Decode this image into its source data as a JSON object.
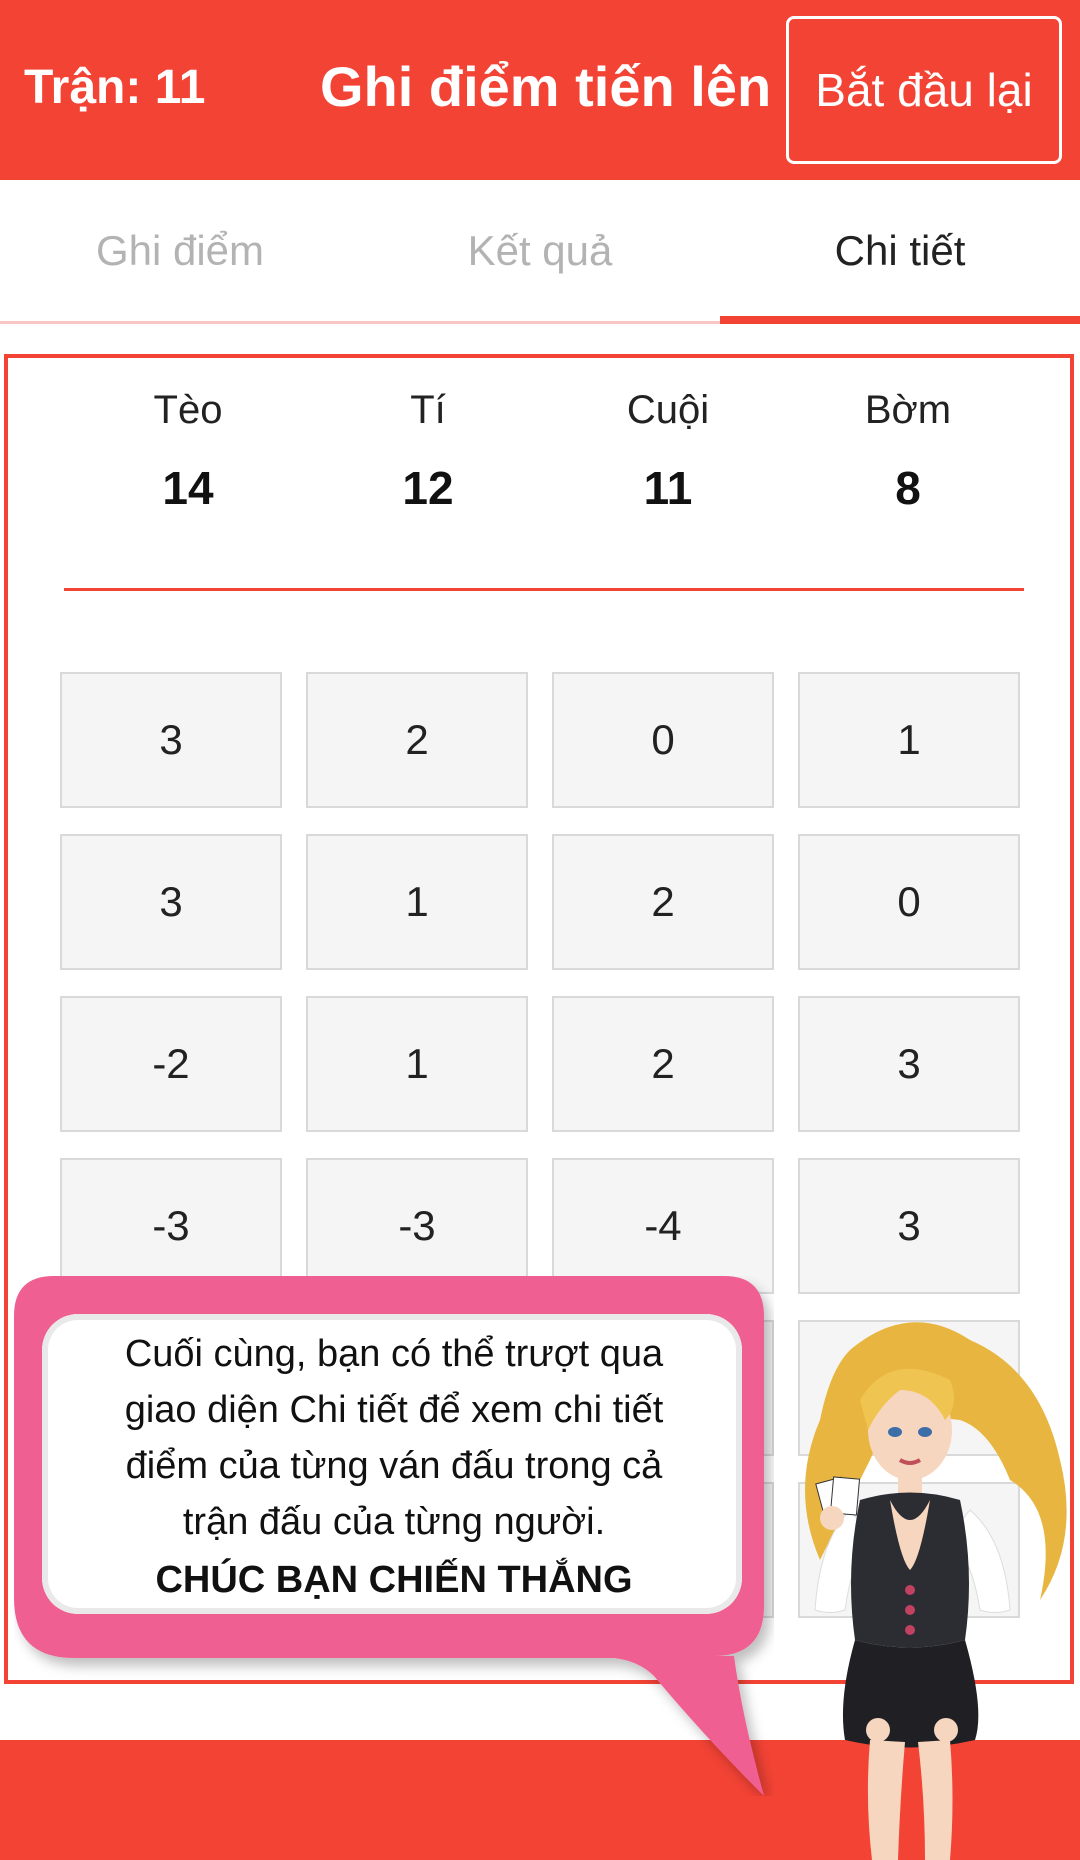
{
  "header": {
    "match_label": "Trận: 11",
    "title": "Ghi điểm tiến lên",
    "restart_label": "Bắt đầu lại"
  },
  "tabs": [
    {
      "label": "Ghi điểm",
      "active": false
    },
    {
      "label": "Kết quả",
      "active": false
    },
    {
      "label": "Chi tiết",
      "active": true
    }
  ],
  "players": [
    {
      "name": "Tèo",
      "total": "14"
    },
    {
      "name": "Tí",
      "total": "12"
    },
    {
      "name": "Cuội",
      "total": "11"
    },
    {
      "name": "Bờm",
      "total": "8"
    }
  ],
  "rounds": [
    [
      "3",
      "2",
      "0",
      "1"
    ],
    [
      "3",
      "1",
      "2",
      "0"
    ],
    [
      "-2",
      "1",
      "2",
      "3"
    ],
    [
      "-3",
      "-3",
      "-4",
      "3"
    ]
  ],
  "tip": {
    "lines": [
      "Cuối cùng, bạn có thể trượt qua",
      "giao diện Chi tiết để xem chi tiết",
      "điểm của từng ván đấu trong cả",
      "trận đấu của từng người."
    ],
    "emphasis": "CHÚC BẠN CHIẾN THẮNG"
  },
  "colors": {
    "accent": "#f34335",
    "bubble_pink": "#ef5f92",
    "cell_bg": "#f5f5f5",
    "inactive_tab": "#b3b3b3"
  }
}
